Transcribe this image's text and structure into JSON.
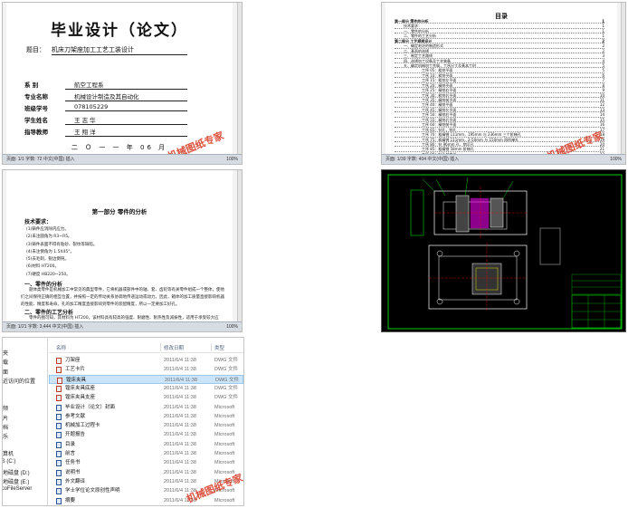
{
  "cover": {
    "title": "毕业设计（论文）",
    "topic_label": "题目：",
    "topic": "机床刀架座加工工艺工装设计",
    "fields": [
      {
        "label": "系    别",
        "value": "航空工程系"
      },
      {
        "label": "专业名称",
        "value": "机械设计制造及其自动化"
      },
      {
        "label": "班级学号",
        "value": "078105229"
      },
      {
        "label": "学生姓名",
        "value": "王 志 华"
      },
      {
        "label": "指导教师",
        "value": "王 翔 洋"
      }
    ],
    "date": "二 Ｏ 一 一  年  06 月",
    "status": "页面: 1/1    字数: 72    中文(中国)    插入",
    "zoom": "100%",
    "watermark": "机械图纸专家"
  },
  "toc": {
    "title": "目录",
    "items": [
      {
        "text": "第一部分   零件的分析",
        "page": "1",
        "level": 1
      },
      {
        "text": "技术要求：",
        "page": "1",
        "level": 2
      },
      {
        "text": "一、零件的分析",
        "page": "1",
        "level": 2
      },
      {
        "text": "二、零件的工艺分析",
        "page": "1",
        "level": 2
      },
      {
        "text": "第二部分   工艺规程设计",
        "page": "2",
        "level": 1
      },
      {
        "text": "一、确定毛坯的制造形式",
        "page": "2",
        "level": 2
      },
      {
        "text": "二、基面的选择",
        "page": "2",
        "level": 2
      },
      {
        "text": "三、制定工艺路线",
        "page": "3",
        "level": 2
      },
      {
        "text": "四、选择加工设备及工艺装备",
        "page": "4",
        "level": 2
      },
      {
        "text": "五、确定机械加工余量，工序尺寸及基本工时",
        "page": "5",
        "level": 2
      },
      {
        "text": "工序 05：粗铣平面",
        "page": "5",
        "level": 3
      },
      {
        "text": "工序 10：粗铣平面",
        "page": "6",
        "level": 3
      },
      {
        "text": "工序 15：粗铣左平面",
        "page": "7",
        "level": 3
      },
      {
        "text": "工序 20：精铣平面",
        "page": "8",
        "level": 3
      },
      {
        "text": "工序 25：精铣右平面",
        "page": "9",
        "level": 3
      },
      {
        "text": "工序 30：粗铣后平面",
        "page": "10",
        "level": 3
      },
      {
        "text": "工序 35：精铣前平面",
        "page": "11",
        "level": 3
      },
      {
        "text": "工序 40：精铣平面",
        "page": "12",
        "level": 3
      },
      {
        "text": "工序 45：精铣左平面",
        "page": "13",
        "level": 3
      },
      {
        "text": "工序 50：精铣右平面",
        "page": "14",
        "level": 3
      },
      {
        "text": "工序 55：精铣后平面",
        "page": "15",
        "level": 3
      },
      {
        "text": "工序 60：精铣前平面",
        "page": "16",
        "level": 3
      },
      {
        "text": "工序 65：钻孔，铰孔",
        "page": "17",
        "level": 3
      },
      {
        "text": "工序 70：粗精镗 111mm，195mm 与 236mm 三个阶梯孔",
        "page": "18",
        "level": 3
      },
      {
        "text": "工序 75：粗精镗 111mm，2-50mm 与 150mm 四阶梯孔",
        "page": "19",
        "level": 3
      },
      {
        "text": "工序 80：钻 96mm 孔，锪沉孔",
        "page": "20",
        "level": 3
      },
      {
        "text": "工序 85：粗精镗 58mm 阶梯孔",
        "page": "21",
        "level": 3
      },
      {
        "text": "工序 90：钻孔并攻丝",
        "page": "22",
        "level": 3
      },
      {
        "text": "工序 95：钻孔并攻丝",
        "page": "23",
        "level": 3
      },
      {
        "text": "工序 100：钻孔并攻丝",
        "page": "24",
        "level": 3
      },
      {
        "text": "工序 105：钻孔并攻丝",
        "page": "25",
        "level": 3
      },
      {
        "text": "工序 110：钻孔并攻丝",
        "page": "26",
        "level": 3
      },
      {
        "text": "工序 115：钻孔并攻丝",
        "page": "27",
        "level": 3
      },
      {
        "text": "工序 120：钻孔并攻丝",
        "page": "28",
        "level": 3
      },
      {
        "text": "工序 125：钻孔并攻丝",
        "page": "29",
        "level": 3
      }
    ],
    "status": "页面: 1/39    字数: 404    中文(中国)    插入",
    "zoom": "100%",
    "watermark": "机械图纸专家"
  },
  "body": {
    "part_title": "第一部分   零件的分析",
    "req_title": "技术要求：",
    "requirements": [
      "(1)铸件应消除内应力。",
      "(2)未注圆角为 R3~R5。",
      "(3)铸件表面不得有粘砂、裂纹等缺陷。",
      "(4)未注倒角为 1.5X45°。",
      "(5)去毛刺，锐边倒钝。",
      "(6)材料 HT200。",
      "(7)硬度 HB220~250。"
    ],
    "sec1_title": "一、零件的分析",
    "sec1_text": "题体类零件是机械加工中常见的典型零件，它将机器或部件中的轴、套、齿轮等有关零件组成一个整体，使他们之间保持正确的相互位置，并按照一定的传动关系协调地传递运动或动力。因此，箱体的加工质量直接影响机器的性能、精度和寿命。孔的加工精度直接影响到零件的装配精度，所以一定要加工好孔。",
    "sec2_title": "二、零件的工艺分析",
    "sec2_text": "零件的图可知，其材料为 HT200，该材料具有较高的强度、耐磨性、耐热性及减振性，适用于承受较大应力，要求耐磨的零件。该零件上的主要加工面为上下平面，前后平面，四个定位孔及四个定位平面等。上下平面的加工精度直接影响到定位孔的加工精度，前后平面的加工精度直接影响到零件的装配精度。",
    "status": "页面: 1/21    字数: 3,444    中文(中国)    插入",
    "zoom": "100%"
  },
  "cad": {
    "line_color": "#ffffff",
    "accent_color": "#00ff00",
    "highlight_color": "#ff00ff",
    "marker_color": "#ff0000",
    "background_color": "#000000"
  },
  "explorer": {
    "nav_items": [
      "藏夹",
      "下载",
      "桌面",
      "最近访问的位置",
      "视频",
      "图片",
      "文档",
      "音乐",
      "计算机",
      "OS (C:)",
      "本地磁盘 (D:)",
      "本地磁盘 (E:)",
      "tycoFileServer"
    ],
    "columns": {
      "name": "名称",
      "date": "修改日期",
      "type": "类型"
    },
    "files": [
      {
        "name": "刀架座",
        "date": "2011/6/4 11:38",
        "type": "DWG 文件",
        "icon": "dwg-file-icon"
      },
      {
        "name": "工艺卡片",
        "date": "2011/6/4 11:38",
        "type": "DWG 文件",
        "icon": "dwg-file-icon"
      },
      {
        "name": "镗床夹具",
        "date": "2011/6/4 11:38",
        "type": "DWG 文件",
        "icon": "dwg-file-icon",
        "selected": true
      },
      {
        "name": "镗床夹具底座",
        "date": "2011/6/4 11:38",
        "type": "DWG 文件",
        "icon": "dwg-file-icon"
      },
      {
        "name": "镗床夹具支座",
        "date": "2011/6/4 11:38",
        "type": "DWG 文件",
        "icon": "dwg-file-icon"
      },
      {
        "name": "毕业设计（论文）封面",
        "date": "2011/6/4 11:38",
        "type": "Microsoft",
        "icon": "word-file-icon"
      },
      {
        "name": "参考文献",
        "date": "2011/6/4 11:38",
        "type": "Microsoft",
        "icon": "word-file-icon"
      },
      {
        "name": "机械加工过程卡",
        "date": "2011/6/4 11:38",
        "type": "Microsoft",
        "icon": "word-file-icon"
      },
      {
        "name": "开题报告",
        "date": "2011/6/4 11:38",
        "type": "Microsoft",
        "icon": "word-file-icon"
      },
      {
        "name": "目录",
        "date": "2011/6/4 11:38",
        "type": "Microsoft",
        "icon": "word-file-icon"
      },
      {
        "name": "前言",
        "date": "2011/6/4 11:38",
        "type": "Microsoft",
        "icon": "word-file-icon"
      },
      {
        "name": "任务书",
        "date": "2011/6/4 11:38",
        "type": "Microsoft",
        "icon": "word-file-icon"
      },
      {
        "name": "说明书",
        "date": "2011/6/4 11:38",
        "type": "Microsoft",
        "icon": "word-file-icon"
      },
      {
        "name": "外文翻译",
        "date": "2011/6/4 11:38",
        "type": "Microsoft",
        "icon": "word-file-icon"
      },
      {
        "name": "学士学位论文原创性声明",
        "date": "2011/6/4 11:38",
        "type": "Microsoft",
        "icon": "word-file-icon"
      },
      {
        "name": "摘要",
        "date": "2011/6/4 11:38",
        "type": "Microsoft",
        "icon": "word-file-icon"
      }
    ],
    "watermark": "机械图纸专家",
    "selected_color": "#cce4f7"
  }
}
